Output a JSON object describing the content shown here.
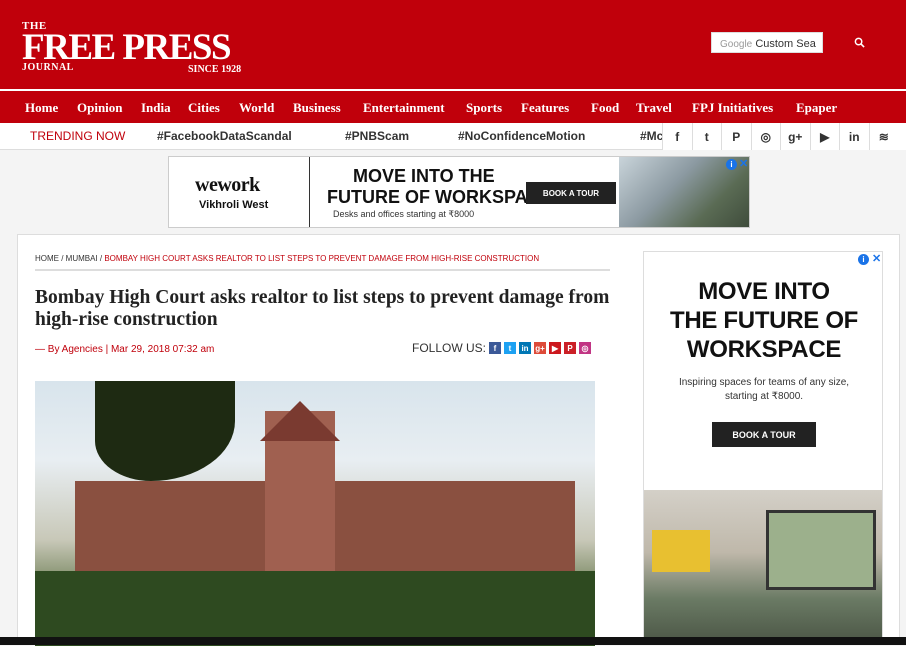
{
  "header": {
    "logo_the": "THE",
    "logo_main": "FREE PRESS",
    "logo_journal": "JOURNAL",
    "logo_since": "SINCE 1928",
    "search_brand": "Google",
    "search_placeholder": "Custom Sea",
    "search_icon": "search-icon"
  },
  "nav": {
    "items": [
      "Home",
      "Opinion",
      "India",
      "Cities",
      "World",
      "Business",
      "Entertainment",
      "Sports",
      "Features",
      "Food",
      "Travel",
      "FPJ Initiatives",
      "Epaper"
    ]
  },
  "trending": {
    "label": "TRENDING NOW",
    "items": [
      "#FacebookDataScandal",
      "#PNBScam",
      "#NoConfidenceMotion",
      "#Mc"
    ],
    "social_icons": [
      "facebook-icon",
      "twitter-icon",
      "pinterest-icon",
      "instagram-icon",
      "google-plus-icon",
      "youtube-icon",
      "linkedin-icon",
      "rss-icon"
    ],
    "social_glyphs": [
      "f",
      "t",
      "P",
      "◎",
      "g+",
      "▶",
      "in",
      "≋"
    ]
  },
  "ad_top": {
    "brand": "wework",
    "location": "Vikhroli West",
    "headline1": "MOVE INTO THE",
    "headline2": "FUTURE OF WORKSPACE",
    "tagline": "Desks and offices starting at ₹8000",
    "cta": "BOOK A TOUR"
  },
  "article": {
    "breadcrumb_home": "HOME",
    "breadcrumb_sep": " / ",
    "breadcrumb_section": "MUMBAI",
    "breadcrumb_current": "BOMBAY HIGH COURT ASKS REALTOR TO LIST STEPS TO PREVENT DAMAGE FROM HIGH-RISE CONSTRUCTION",
    "title": "Bombay High Court asks realtor to list steps to prevent damage from high-rise construction",
    "byline": "— By Agencies | Mar 29, 2018 07:32 am",
    "follow_label": "FOLLOW US:",
    "follow_icons": [
      "f",
      "t",
      "in",
      "g+",
      "▶",
      "P",
      "◎"
    ],
    "follow_colors": [
      "#3b5998",
      "#1da1f2",
      "#0077b5",
      "#dd4b39",
      "#cc181e",
      "#cb2027",
      "#c13584"
    ]
  },
  "ad_right": {
    "headline1": "MOVE INTO",
    "headline2": "THE FUTURE OF",
    "headline3": "WORKSPACE",
    "subtext": "Inspiring spaces for teams of any size, starting at ₹8000.",
    "cta": "BOOK A TOUR"
  },
  "ad_badge": {
    "info": "i",
    "close": "✕"
  }
}
